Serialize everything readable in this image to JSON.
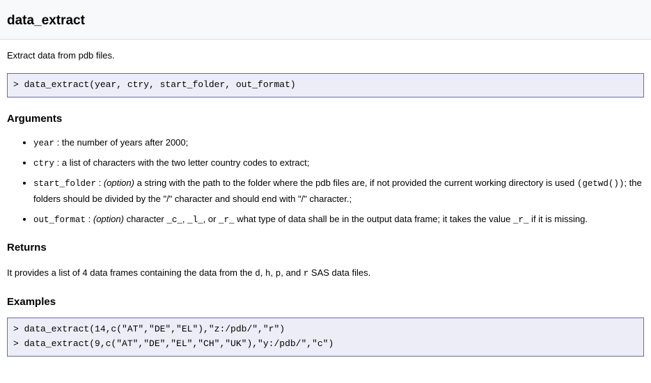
{
  "title": "data_extract",
  "description": "Extract data from pdb files.",
  "signature": "> data_extract(year, ctry, start_folder, out_format)",
  "arguments_heading": "Arguments",
  "arguments": [
    {
      "name": "year",
      "option": false,
      "desc_prefix": "",
      "desc": "the number of years after 2000;",
      "tail_code": "",
      "tail_text": ""
    },
    {
      "name": "ctry",
      "option": false,
      "desc_prefix": "",
      "desc": "a list of characters with the two letter country codes to extract;",
      "tail_code": "",
      "tail_text": ""
    },
    {
      "name": "start_folder",
      "option": true,
      "desc_prefix": "",
      "desc": "a string with the path to the folder where the pdb files are, if not provided the current working directory is used ",
      "tail_code": "(getwd())",
      "tail_text": "; the folders should be divided by the \"/\" character and should end with \"/\" character.;"
    },
    {
      "name": "out_format",
      "option": true,
      "desc_prefix": "",
      "desc": "character ",
      "vals": [
        "_c_",
        "_l_",
        "_r_"
      ],
      "vals_sep": [
        ", ",
        ", or "
      ],
      "desc2": " what type of data shall be in the output data frame; it takes the value ",
      "desc2_code": "_r_",
      "desc2_tail": " if it is missing."
    }
  ],
  "returns_heading": "Returns",
  "returns_text_pre": "It provides a list of 4 data frames containing the data from the ",
  "returns_files": [
    "d",
    "h",
    "p",
    "r"
  ],
  "returns_files_joiner": ", ",
  "returns_files_last_joiner": ", and ",
  "returns_text_post": " SAS data files.",
  "examples_heading": "Examples",
  "examples": "> data_extract(14,c(\"AT\",\"DE\",\"EL\"),\"z:/pdb/\",\"r\")\n> data_extract(9,c(\"AT\",\"DE\",\"EL\",\"CH\",\"UK\"),\"y:/pdb/\",\"c\")"
}
